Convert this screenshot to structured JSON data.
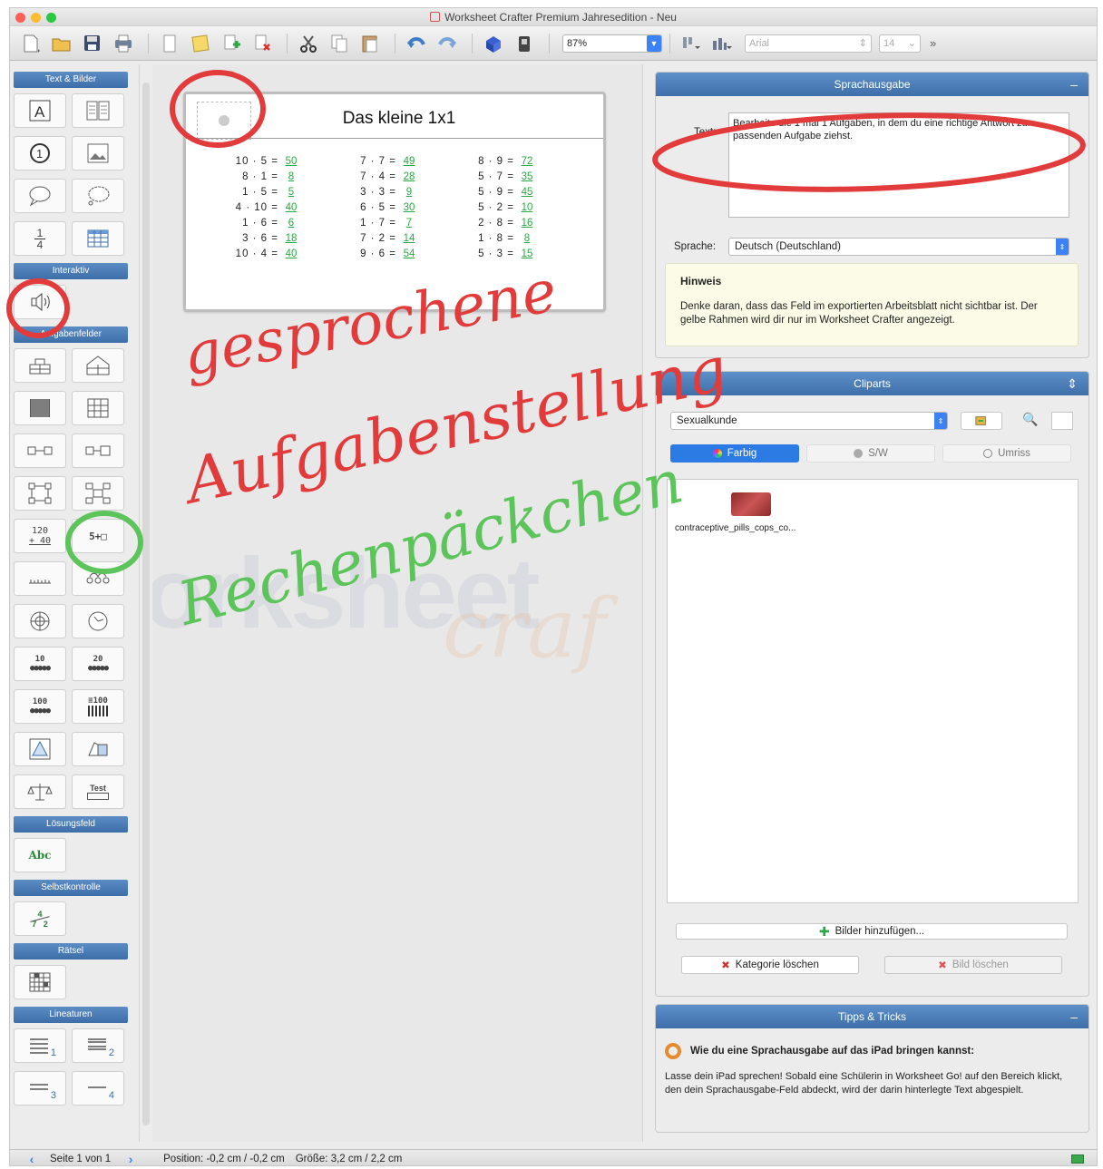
{
  "window": {
    "title": "Worksheet Crafter Premium Jahresedition - Neu"
  },
  "toolbar": {
    "zoom_value": "87%",
    "font_value": "Arial",
    "font_size_value": "14",
    "overflow_label": "»",
    "icons": [
      "new-document-icon",
      "open-folder-icon",
      "save-icon",
      "print-icon",
      "page-icon",
      "notes-icon",
      "add-page-icon",
      "delete-page-icon",
      "cut-icon",
      "copy-icon",
      "paste-icon",
      "undo-icon",
      "redo-icon",
      "puzzle-icon",
      "lock-icon",
      "align-icon",
      "distribute-icon"
    ]
  },
  "palette": {
    "sections": [
      {
        "title": "Text & Bilder"
      },
      {
        "title": "Interaktiv"
      },
      {
        "title": "Aufgabenfelder"
      },
      {
        "title": "Lösungsfeld"
      },
      {
        "title": "Selbstkontrolle"
      },
      {
        "title": "Rätsel"
      },
      {
        "title": "Lineaturen"
      }
    ],
    "button_labels": {
      "fraction_top": "1",
      "fraction_bottom": "4",
      "calc_top": "120",
      "calc_bottom": "+ 40",
      "chain": "5+□",
      "dots10": "10",
      "dots20": "20",
      "dots100": "100",
      "grid100": "≡100",
      "test": "Test",
      "solution": "Abc",
      "self_top": "4",
      "self_bottom": "7   2",
      "line1": "1",
      "line2": "2",
      "line3": "3",
      "line4": "4"
    }
  },
  "worksheet": {
    "title": "Das kleine 1x1",
    "tasks": [
      {
        "q": "10 · 5 =",
        "a": "50"
      },
      {
        "q": "7 · 7 =",
        "a": "49"
      },
      {
        "q": "8 · 9 =",
        "a": "72"
      },
      {
        "q": "8 · 1 =",
        "a": "8"
      },
      {
        "q": "7 · 4 =",
        "a": "28"
      },
      {
        "q": "5 · 7 =",
        "a": "35"
      },
      {
        "q": "1 · 5 =",
        "a": "5"
      },
      {
        "q": "3 · 3 =",
        "a": "9"
      },
      {
        "q": "5 · 9 =",
        "a": "45"
      },
      {
        "q": "4 · 10 =",
        "a": "40"
      },
      {
        "q": "6 · 5 =",
        "a": "30"
      },
      {
        "q": "5 · 2 =",
        "a": "10"
      },
      {
        "q": "1 · 6 =",
        "a": "6"
      },
      {
        "q": "1 · 7 =",
        "a": "7"
      },
      {
        "q": "2 · 8 =",
        "a": "16"
      },
      {
        "q": "3 · 6 =",
        "a": "18"
      },
      {
        "q": "7 · 2 =",
        "a": "14"
      },
      {
        "q": "1 · 8 =",
        "a": "8"
      },
      {
        "q": "10 · 4 =",
        "a": "40"
      },
      {
        "q": "9 · 6 =",
        "a": "54"
      },
      {
        "q": "5 · 3 =",
        "a": "15"
      }
    ]
  },
  "watermark": {
    "text1": "orksheet",
    "text2": "craf"
  },
  "annotations": {
    "red_line1": "gesprochene",
    "red_line2": "Aufgabenstellung",
    "green_line": "Rechenpäckchen",
    "red_color": "#e23b3b",
    "green_color": "#5cc45a"
  },
  "speech_panel": {
    "title": "Sprachausgabe",
    "collapse": "–",
    "text_label": "Text:",
    "text_value": "Bearbeite die 1 mal 1 Aufgaben, in dem du eine richtige Antwort zur passenden Aufgabe ziehst.",
    "language_label": "Sprache:",
    "language_value": "Deutsch (Deutschland)",
    "hint_title": "Hinweis",
    "hint_text": "Denke daran, dass das Feld im exportierten Arbeitsblatt nicht sichtbar ist. Der gelbe Rahmen wird dir nur im Worksheet Crafter angezeigt."
  },
  "cliparts_panel": {
    "title": "Cliparts",
    "control": "⇕",
    "category_value": "Sexualkunde",
    "tabs": [
      {
        "label": "Farbig",
        "active": true
      },
      {
        "label": "S/W",
        "active": false
      },
      {
        "label": "Umriss",
        "active": false
      }
    ],
    "items": [
      {
        "label": "contraceptive_pills_cops_co..."
      }
    ],
    "add_images_label": "Bilder hinzufügen...",
    "delete_category_label": "Kategorie löschen",
    "delete_image_label": "Bild löschen"
  },
  "tips_panel": {
    "title": "Tipps & Tricks",
    "collapse": "–",
    "heading": "Wie du eine Sprachausgabe auf das iPad bringen kannst:",
    "body": "Lasse dein iPad sprechen! Sobald eine Schülerin in Worksheet Go! auf den Bereich klickt, den dein Sprachausgabe-Feld abdeckt, wird der darin hinterlegte Text abgespielt."
  },
  "statusbar": {
    "page": "Seite 1 von 1",
    "position": "Position: -0,2 cm / -0,2 cm",
    "size": "Größe: 3,2 cm / 2,2 cm"
  },
  "colors": {
    "accent_blue": "#3d6ea8",
    "answer_green": "#2aa845",
    "hint_bg": "#fbfbe8"
  }
}
